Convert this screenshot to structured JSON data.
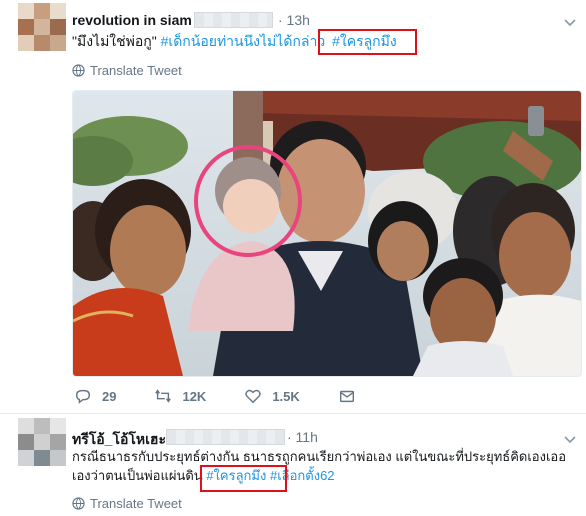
{
  "tweet1": {
    "name": "revolution in siam",
    "time": "· 13h",
    "text_quote": "\"มึงไม่ใช่พ่อกู\"",
    "tags": [
      "#เด็กน้อยท่านนึงไม่ได้กล่าว",
      "#ใครลูกมึง"
    ],
    "translate": "Translate Tweet",
    "actions": {
      "replies": "29",
      "retweets": "12K",
      "likes": "1.5K"
    }
  },
  "tweet2": {
    "name": "ทรีโอ้_โอ้โหเฮะ",
    "time": "· 11h",
    "line1": "กรณีธนาธรกับประยุทธ์ต่างกัน ธนาธรถูกคนเรียกว่าพ่อเอง แต่ในขณะที่ประยุทธ์คิดเองเออ",
    "line2_prefix": "เองว่าตนเป็นพ่อแผ่นดิน",
    "tags": [
      "#ใครลูกมึง",
      "#เลือกตั้ง62"
    ],
    "translate": "Translate Tweet"
  },
  "colors": {
    "link": "#1b95e0",
    "highlight_box": "#e0101a",
    "muted": "#657786"
  },
  "icons": [
    "globe-icon",
    "reply-icon",
    "retweet-icon",
    "heart-icon",
    "dm-icon",
    "chevron-down-icon"
  ]
}
